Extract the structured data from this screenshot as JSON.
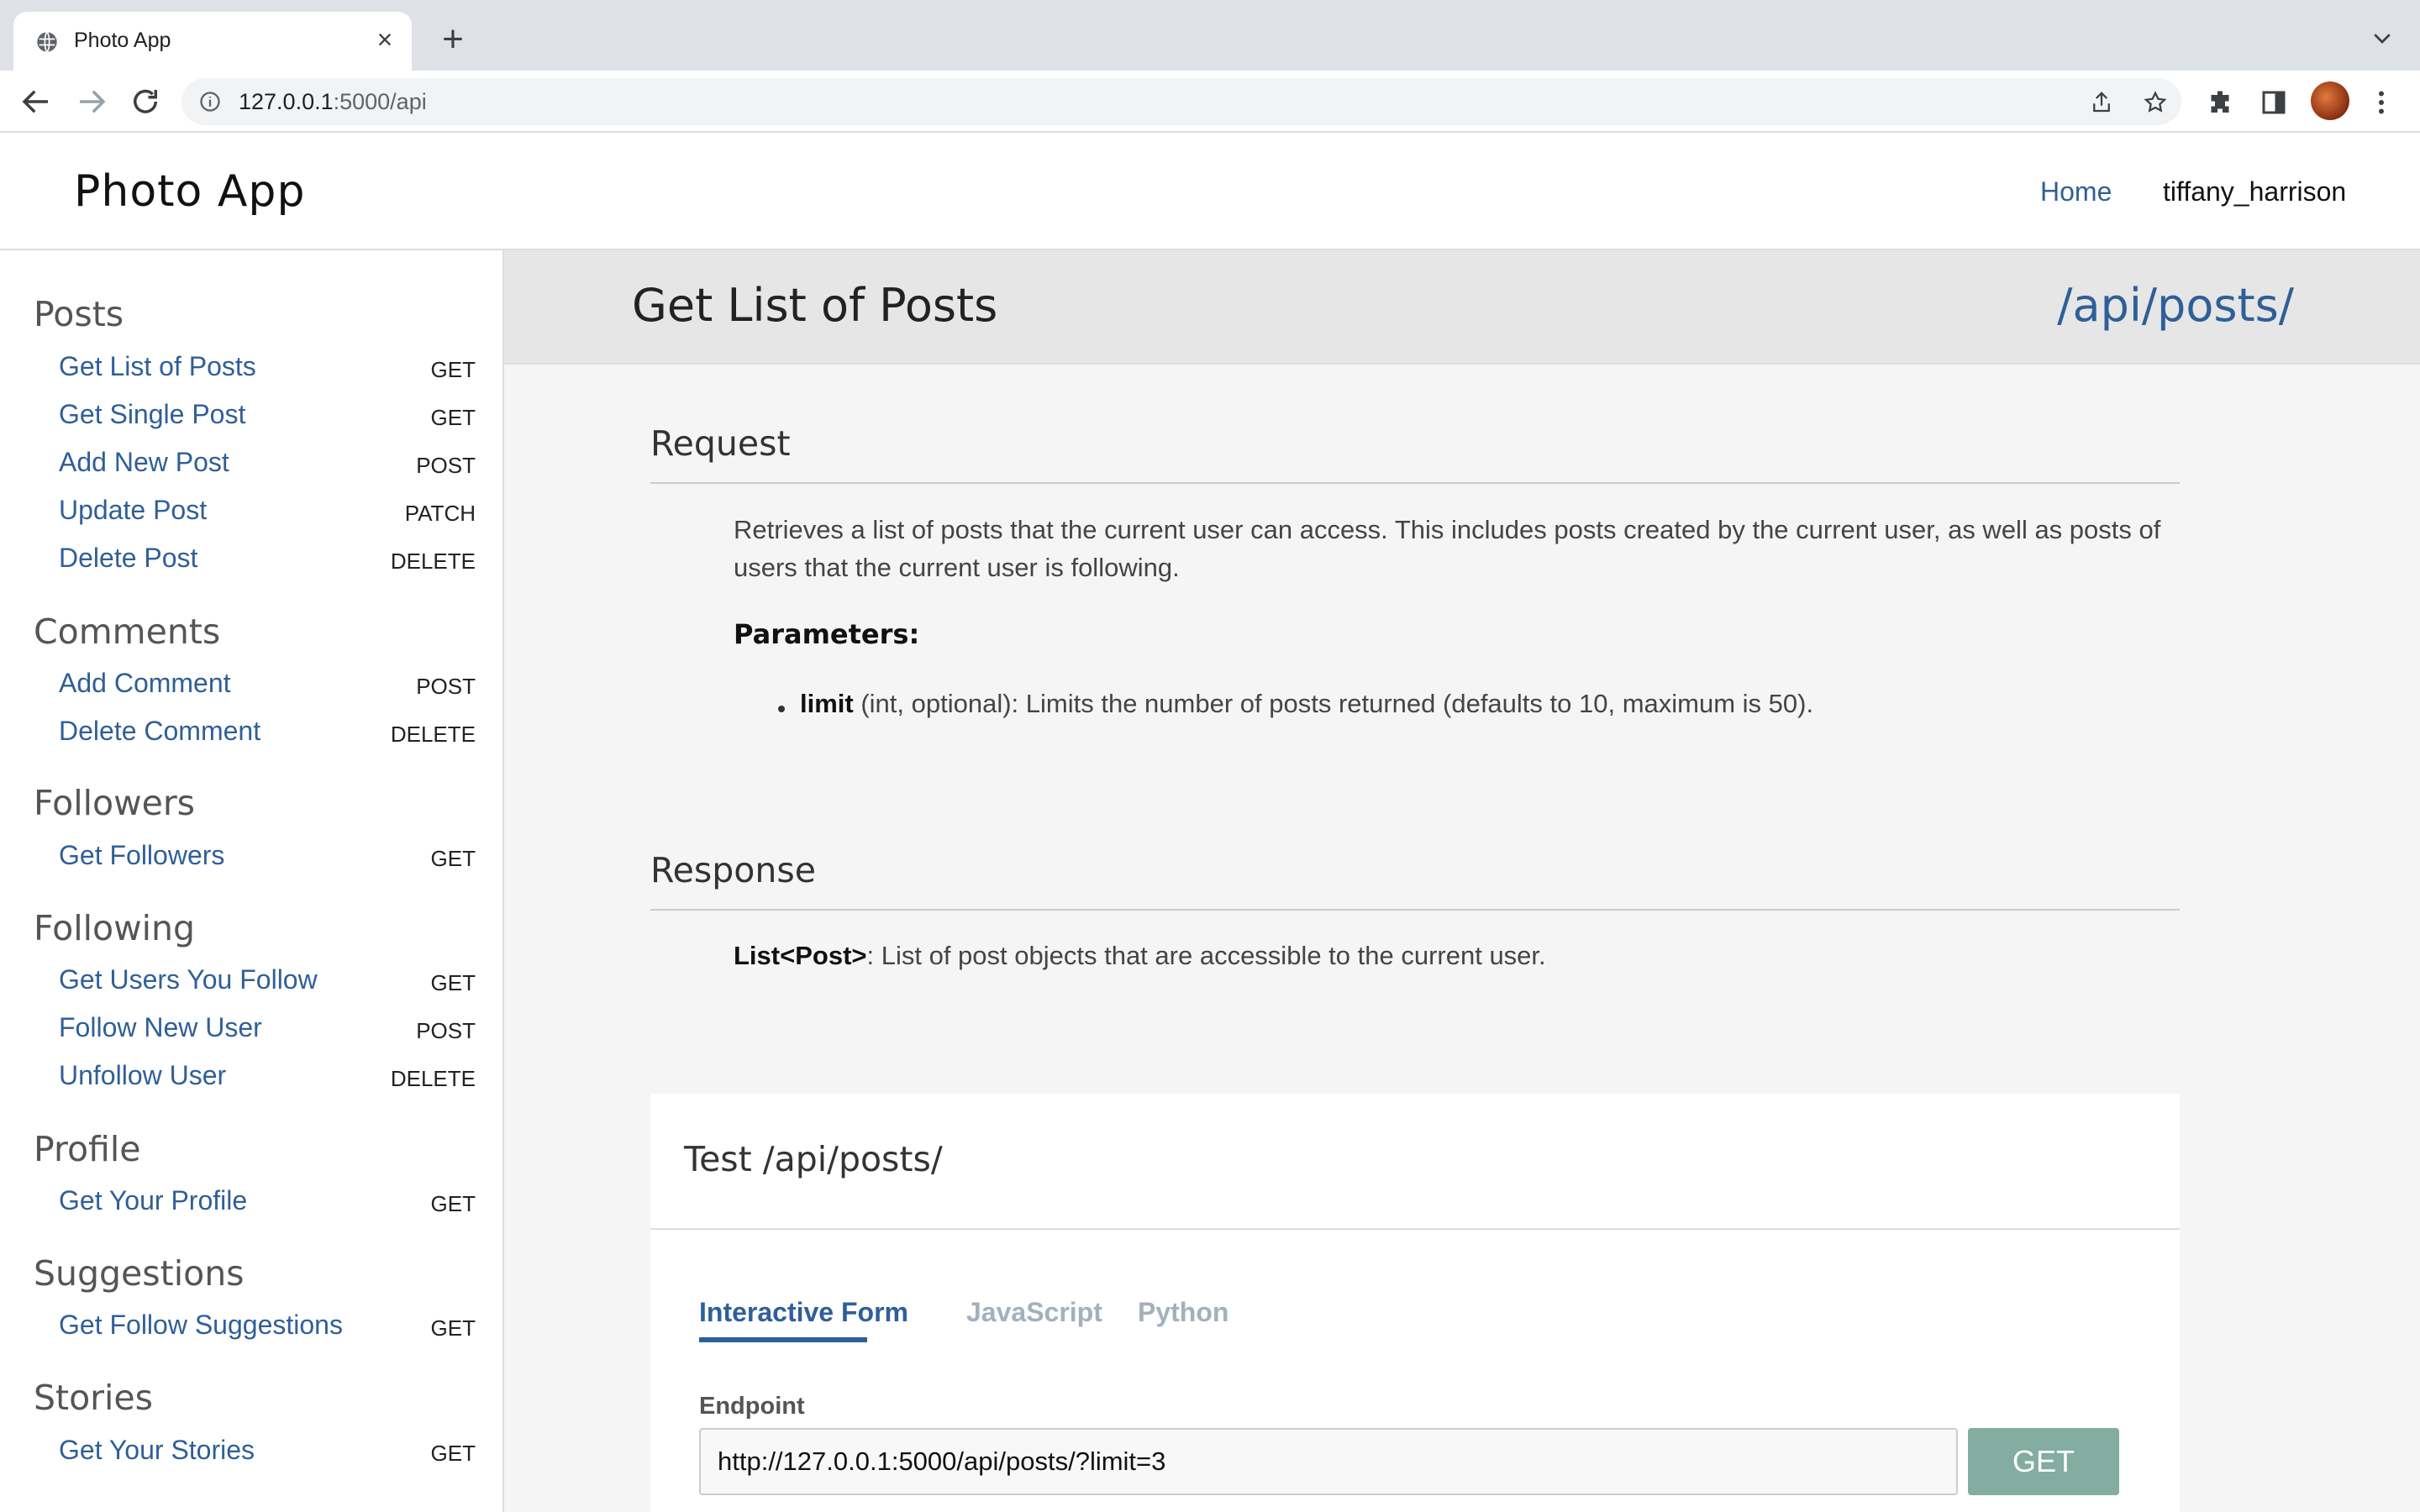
{
  "browser": {
    "tab_title": "Photo App",
    "tab_icon": "globe-icon",
    "url_host": "127.0.0.1",
    "url_rest": ":5000/api"
  },
  "header": {
    "logo": "Photo App",
    "home_link": "Home",
    "username": "tiffany_harrison"
  },
  "sidebar": {
    "sections": [
      {
        "title": "Posts",
        "items": [
          {
            "label": "Get List of Posts",
            "method": "GET"
          },
          {
            "label": "Get Single Post",
            "method": "GET"
          },
          {
            "label": "Add New Post",
            "method": "POST"
          },
          {
            "label": "Update Post",
            "method": "PATCH"
          },
          {
            "label": "Delete Post",
            "method": "DELETE"
          }
        ]
      },
      {
        "title": "Comments",
        "items": [
          {
            "label": "Add Comment",
            "method": "POST"
          },
          {
            "label": "Delete Comment",
            "method": "DELETE"
          }
        ]
      },
      {
        "title": "Followers",
        "items": [
          {
            "label": "Get Followers",
            "method": "GET"
          }
        ]
      },
      {
        "title": "Following",
        "items": [
          {
            "label": "Get Users You Follow",
            "method": "GET"
          },
          {
            "label": "Follow New User",
            "method": "POST"
          },
          {
            "label": "Unfollow User",
            "method": "DELETE"
          }
        ]
      },
      {
        "title": "Profile",
        "items": [
          {
            "label": "Get Your Profile",
            "method": "GET"
          }
        ]
      },
      {
        "title": "Suggestions",
        "items": [
          {
            "label": "Get Follow Suggestions",
            "method": "GET"
          }
        ]
      },
      {
        "title": "Stories",
        "items": [
          {
            "label": "Get Your Stories",
            "method": "GET"
          }
        ]
      }
    ]
  },
  "main": {
    "title": "Get List of Posts",
    "endpoint": "/api/posts/",
    "request": {
      "heading": "Request",
      "description": "Retrieves a list of posts that the current user can access. This includes posts created by the current user, as well as posts of users that the current user is following.",
      "params_heading": "Parameters:",
      "param_name": "limit",
      "param_desc": " (int, optional): Limits the number of posts returned (defaults to 10, maximum is 50)."
    },
    "response": {
      "heading": "Response",
      "type": "List<Post>",
      "desc": ": List of post objects that are accessible to the current user."
    },
    "test": {
      "title": "Test /api/posts/",
      "tabs": [
        "Interactive Form",
        "JavaScript",
        "Python"
      ],
      "endpoint_label": "Endpoint",
      "endpoint_value": "http://127.0.0.1:5000/api/posts/?limit=3",
      "submit_label": "GET"
    }
  },
  "colors": {
    "link": "#2f5f98",
    "button": "#82ada0"
  }
}
